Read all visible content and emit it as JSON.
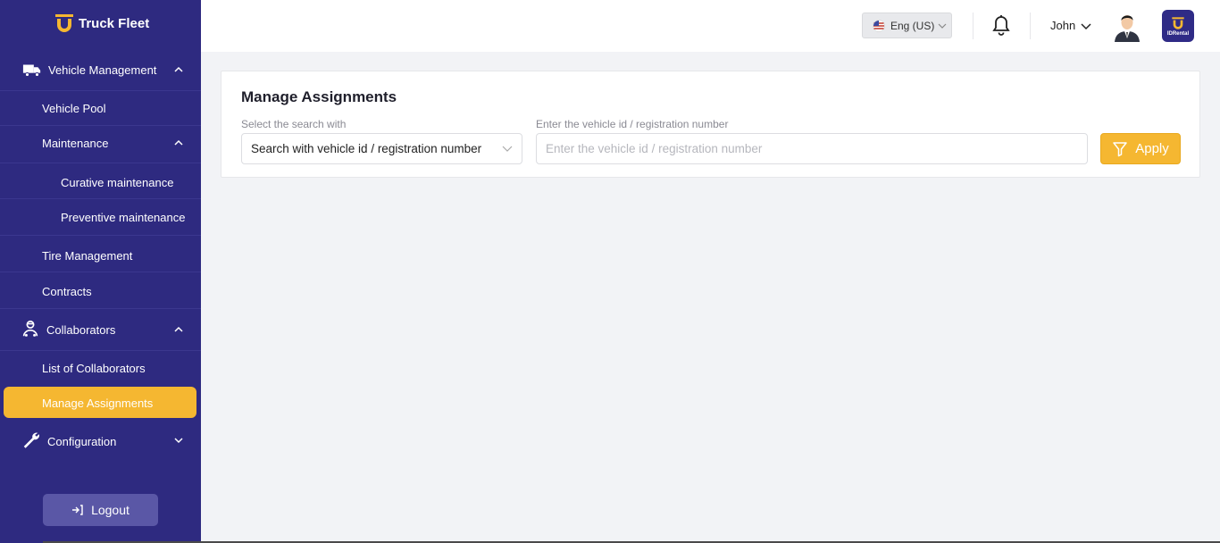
{
  "brand": {
    "name": "Truck Fleet"
  },
  "sidebar": {
    "vehicle_management": "Vehicle Management",
    "vehicle_pool": "Vehicle Pool",
    "maintenance": "Maintenance",
    "curative_maintenance": "Curative maintenance",
    "preventive_maintenance": "Preventive maintenance",
    "tire_management": "Tire Management",
    "contracts": "Contracts",
    "collaborators": "Collaborators",
    "list_of_collaborators": "List of Collaborators",
    "manage_assignments": "Manage Assignments",
    "configuration": "Configuration",
    "logout": "Logout",
    "active_item": "Manage Assignments"
  },
  "header": {
    "language": "Eng (US)",
    "user_name": "John",
    "app_logo_text": "IDRental"
  },
  "main": {
    "title": "Manage Assignments",
    "select_label": "Select the search with",
    "select_value": "Search with vehicle id / registration number",
    "input_label": "Enter the vehicle id / registration number",
    "input_placeholder": "Enter the vehicle id / registration number",
    "input_value": "",
    "apply_label": "Apply"
  },
  "colors": {
    "sidebar_bg": "#2e2a80",
    "accent": "#f5b731",
    "page_bg": "#f2f3f6"
  }
}
